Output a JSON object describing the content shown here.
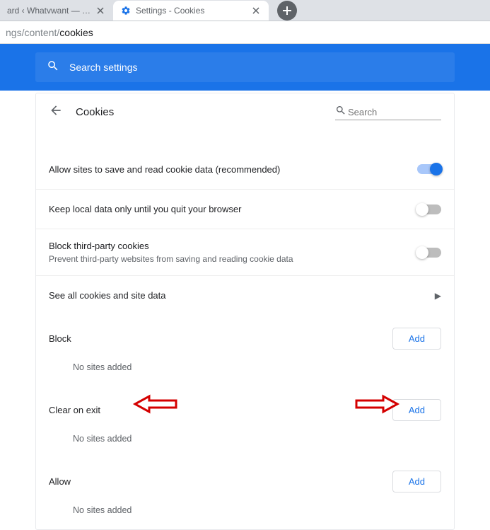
{
  "tabs": {
    "inactive": {
      "title": "ard ‹ Whatvwant — Wor…"
    },
    "active": {
      "title": "Settings - Cookies"
    }
  },
  "url": {
    "dim1": "ngs",
    "dim2": "/content/",
    "path": "cookies"
  },
  "search_settings": {
    "placeholder": "Search settings"
  },
  "panel": {
    "title": "Cookies",
    "search_placeholder": "Search"
  },
  "rows": {
    "allow_save": {
      "label": "Allow sites to save and read cookie data (recommended)"
    },
    "keep_local": {
      "label": "Keep local data only until you quit your browser"
    },
    "block_third": {
      "label": "Block third-party cookies",
      "sublabel": "Prevent third-party websites from saving and reading cookie data"
    },
    "see_all": {
      "label": "See all cookies and site data"
    }
  },
  "sections": {
    "block": {
      "title": "Block",
      "add": "Add",
      "empty": "No sites added"
    },
    "clear_on_exit": {
      "title": "Clear on exit",
      "add": "Add",
      "empty": "No sites added"
    },
    "allow": {
      "title": "Allow",
      "add": "Add",
      "empty": "No sites added"
    }
  }
}
